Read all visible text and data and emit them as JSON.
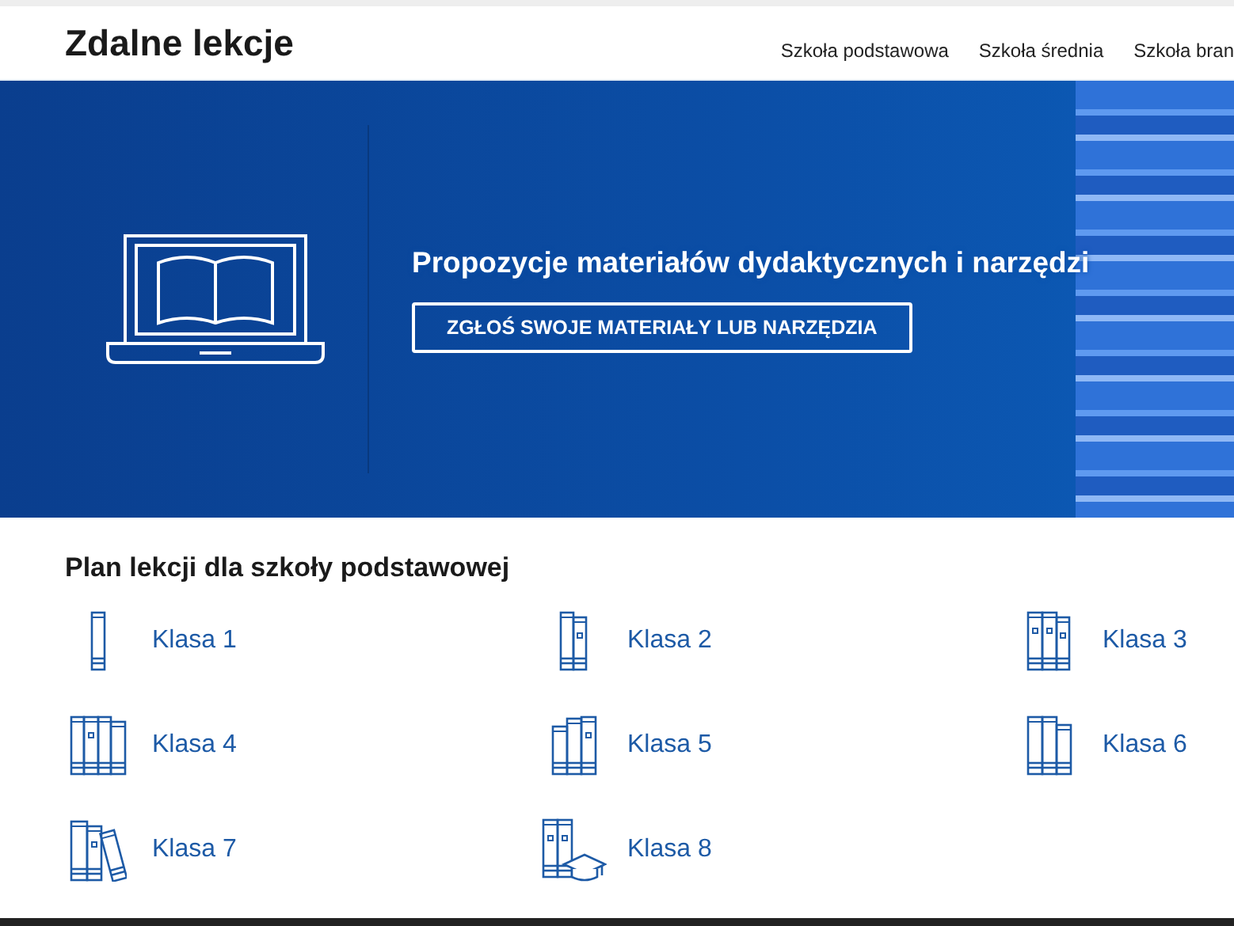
{
  "header": {
    "title": "Zdalne lekcje",
    "nav": [
      {
        "label": "Szkoła podstawowa"
      },
      {
        "label": "Szkoła średnia"
      },
      {
        "label": "Szkoła bran"
      }
    ]
  },
  "banner": {
    "heading": "Propozycje materiałów dydaktycznych i narzędzi",
    "button": "ZGŁOŚ SWOJE MATERIAŁY LUB NARZĘDZIA"
  },
  "section": {
    "heading": "Plan lekcji dla szkoły podstawowej",
    "items": [
      {
        "label": "Klasa 1"
      },
      {
        "label": "Klasa 2"
      },
      {
        "label": "Klasa 3"
      },
      {
        "label": "Klasa 4"
      },
      {
        "label": "Klasa 5"
      },
      {
        "label": "Klasa 6"
      },
      {
        "label": "Klasa 7"
      },
      {
        "label": "Klasa 8"
      }
    ]
  }
}
